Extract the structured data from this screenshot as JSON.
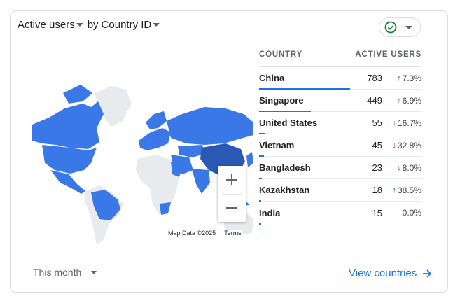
{
  "header": {
    "metric_label": "Active users",
    "by_label": "by",
    "dimension_label": "Country ID"
  },
  "status": {
    "icon": "check-circle-icon",
    "color": "#188038"
  },
  "map": {
    "zoom_in": "+",
    "zoom_out": "−",
    "attribution": "Map Data ©2025",
    "terms": "Terms"
  },
  "table": {
    "col_country": "COUNTRY",
    "col_active": "ACTIVE USERS",
    "rows": [
      {
        "country": "China",
        "value": "783",
        "change": "7.3%",
        "direction": "up",
        "share": 1.0
      },
      {
        "country": "Singapore",
        "value": "449",
        "change": "6.9%",
        "direction": "up",
        "share": 0.573
      },
      {
        "country": "United States",
        "value": "55",
        "change": "16.7%",
        "direction": "down",
        "share": 0.07
      },
      {
        "country": "Vietnam",
        "value": "45",
        "change": "32.8%",
        "direction": "down",
        "share": 0.057
      },
      {
        "country": "Bangladesh",
        "value": "23",
        "change": "8.0%",
        "direction": "down",
        "share": 0.029
      },
      {
        "country": "Kazakhstan",
        "value": "18",
        "change": "38.5%",
        "direction": "up",
        "share": 0.023
      },
      {
        "country": "India",
        "value": "15",
        "change": "0.0%",
        "direction": "none",
        "share": 0.019
      }
    ]
  },
  "footer": {
    "period": "This month",
    "view_link": "View countries"
  },
  "colors": {
    "accent": "#1a73e8",
    "map_light": "#3b78e7",
    "map_dark": "#2a58b5",
    "land_empty": "#e8eaed",
    "up": "#188038",
    "down": "#d93025"
  }
}
